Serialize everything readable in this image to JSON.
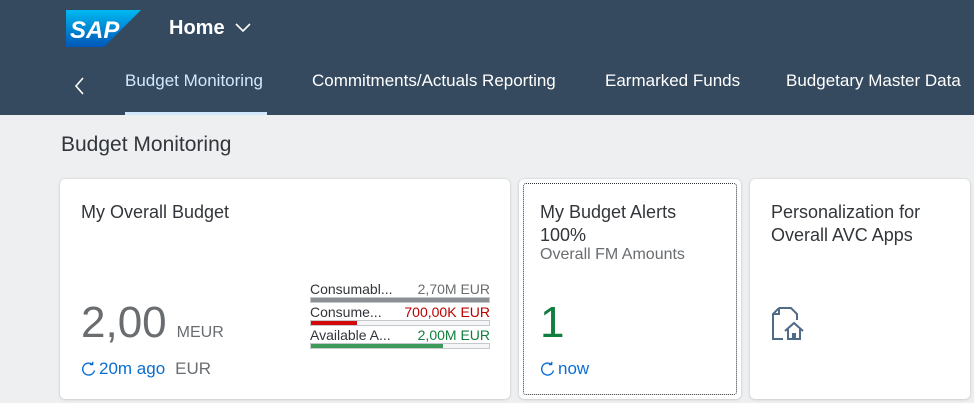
{
  "colors": {
    "shell_bg": "#354a5f",
    "page_bg": "#edeff0",
    "active_tab": "#d1e8ff",
    "link": "#0a6ed1",
    "neutral_bar": "#8c9094",
    "critical": "#bb0000",
    "critical_bar": "#d20a0a",
    "good": "#107e3e",
    "good_bar": "#3e9a5a"
  },
  "header": {
    "logo_text": "SAP",
    "home_label": "Home",
    "home_icon": "chevron-down-icon",
    "back_icon": "chevron-left-icon"
  },
  "tabs": [
    {
      "label": "Budget Monitoring",
      "active": true
    },
    {
      "label": "Commitments/Actuals Reporting",
      "active": false
    },
    {
      "label": "Earmarked Funds",
      "active": false
    },
    {
      "label": "Budgetary Master Data",
      "active": false
    }
  ],
  "section": {
    "title": "Budget Monitoring"
  },
  "tiles": {
    "overall": {
      "title": "My Overall Budget",
      "value": "2,00",
      "unit": "MEUR",
      "refresh_time": "20m ago",
      "footer_unit": "EUR",
      "refresh_icon": "refresh-icon",
      "chart": [
        {
          "label": "Consumabl...",
          "value": "2,70M EUR",
          "fill": 1.0,
          "state": "neutral"
        },
        {
          "label": "Consume...",
          "value": "700,00K EUR",
          "fill": 0.26,
          "state": "critical"
        },
        {
          "label": "Available A...",
          "value": "2,00M EUR",
          "fill": 0.74,
          "state": "good"
        }
      ]
    },
    "alerts": {
      "title_line1": "My Budget Alerts",
      "title_line2": "100%",
      "subtitle": "Overall FM Amounts",
      "count": "1",
      "refresh_time": "now",
      "refresh_icon": "refresh-icon"
    },
    "personalization": {
      "title_line1": "Personalization for",
      "title_line2": "Overall AVC Apps",
      "icon": "document-home-icon"
    }
  }
}
